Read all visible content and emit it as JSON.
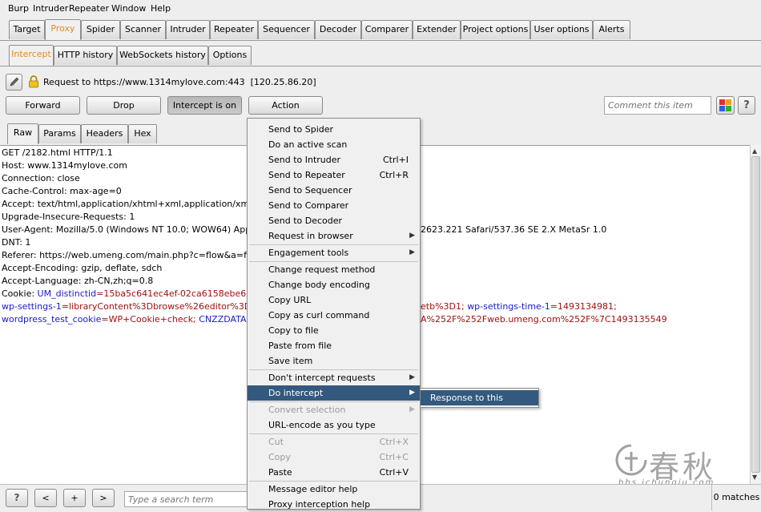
{
  "menubar": [
    "Burp",
    "Intruder",
    "Repeater",
    "Window",
    "Help"
  ],
  "main_tabs": [
    "Target",
    "Proxy",
    "Spider",
    "Scanner",
    "Intruder",
    "Repeater",
    "Sequencer",
    "Decoder",
    "Comparer",
    "Extender",
    "Project options",
    "User options",
    "Alerts"
  ],
  "proxy_tabs": [
    "Intercept",
    "HTTP history",
    "WebSockets history",
    "Options"
  ],
  "request_info": "Request to https://www.1314mylove.com:443  [120.25.86.20]",
  "buttons": {
    "forward": "Forward",
    "drop": "Drop",
    "intercept": "Intercept is on",
    "action": "Action",
    "help": "?"
  },
  "comment_placeholder": "Comment this item",
  "editor_tabs": [
    "Raw",
    "Params",
    "Headers",
    "Hex"
  ],
  "request_lines": [
    "GET /2182.html HTTP/1.1",
    "Host: www.1314mylove.com",
    "Connection: close",
    "Cache-Control: max-age=0",
    "Accept: text/html,application/xhtml+xml,application/xml;q=0.9,ima",
    "Upgrade-Insecure-Requests: 1",
    "User-Agent: Mozilla/5.0 (Windows NT 10.0; WOW64) AppleWeb",
    "DNT: 1",
    "Referer: https://web.umeng.com/main.php?c=flow&a=frame&sit",
    "Accept-Encoding: gzip, deflate, sdch",
    "Accept-Language: zh-CN,zh;q=0.8"
  ],
  "user_agent_tail": "2623.221 Safari/537.36 SE 2.X MetaSr 1.0",
  "cookie": {
    "label": "Cookie: ",
    "l1_key": "UM_distinctid",
    "l1_val": "=15ba5c641ec4ef-02ca6158ebe613-4d01",
    "l2_key": "wp-settings-1",
    "l2_val": "=libraryContent%3Dbrowse%26editor%3Dhtml%2",
    "l2_tail_val": "etb%3D1; ",
    "l2_tail_key": "wp-settings-time-1",
    "l2_tail_val2": "=1493134981;",
    "l3_key": "wordpress_test_cookie",
    "l3_val": "=WP+Cookie+check; ",
    "l3_key2": "CNZZDATA126059",
    "l3_tail": "A%252F%252Fweb.umeng.com%252F%7C1493135549"
  },
  "context_menu": [
    {
      "label": "Send to Spider",
      "accel": "",
      "submenu": false,
      "disabled": false
    },
    {
      "label": "Do an active scan",
      "accel": "",
      "submenu": false,
      "disabled": false
    },
    {
      "label": "Send to Intruder",
      "accel": "Ctrl+I",
      "submenu": false,
      "disabled": false
    },
    {
      "label": "Send to Repeater",
      "accel": "Ctrl+R",
      "submenu": false,
      "disabled": false
    },
    {
      "label": "Send to Sequencer",
      "accel": "",
      "submenu": false,
      "disabled": false
    },
    {
      "label": "Send to Comparer",
      "accel": "",
      "submenu": false,
      "disabled": false
    },
    {
      "label": "Send to Decoder",
      "accel": "",
      "submenu": false,
      "disabled": false
    },
    {
      "label": "Request in browser",
      "accel": "",
      "submenu": true,
      "disabled": false
    },
    {
      "label": "Engagement tools",
      "accel": "",
      "submenu": true,
      "disabled": false
    },
    {
      "label": "Change request method",
      "accel": "",
      "submenu": false,
      "disabled": false
    },
    {
      "label": "Change body encoding",
      "accel": "",
      "submenu": false,
      "disabled": false
    },
    {
      "label": "Copy URL",
      "accel": "",
      "submenu": false,
      "disabled": false
    },
    {
      "label": "Copy as curl command",
      "accel": "",
      "submenu": false,
      "disabled": false
    },
    {
      "label": "Copy to file",
      "accel": "",
      "submenu": false,
      "disabled": false
    },
    {
      "label": "Paste from file",
      "accel": "",
      "submenu": false,
      "disabled": false
    },
    {
      "label": "Save item",
      "accel": "",
      "submenu": false,
      "disabled": false
    },
    {
      "label": "Don't intercept requests",
      "accel": "",
      "submenu": true,
      "disabled": false
    },
    {
      "label": "Do intercept",
      "accel": "",
      "submenu": true,
      "disabled": false
    },
    {
      "label": "Convert selection",
      "accel": "",
      "submenu": true,
      "disabled": true
    },
    {
      "label": "URL-encode as you type",
      "accel": "",
      "submenu": false,
      "disabled": false
    },
    {
      "label": "Cut",
      "accel": "Ctrl+X",
      "submenu": false,
      "disabled": true
    },
    {
      "label": "Copy",
      "accel": "Ctrl+C",
      "submenu": false,
      "disabled": true
    },
    {
      "label": "Paste",
      "accel": "Ctrl+V",
      "submenu": false,
      "disabled": false
    },
    {
      "label": "Message editor help",
      "accel": "",
      "submenu": false,
      "disabled": false
    },
    {
      "label": "Proxy interception help",
      "accel": "",
      "submenu": false,
      "disabled": false
    }
  ],
  "submenu_item": "Response to this request",
  "bottom": {
    "help": "?",
    "prev": "<",
    "add": "+",
    "next": ">",
    "search_placeholder": "Type a search term",
    "matches": "0 matches"
  },
  "watermark": {
    "chars": "春秋",
    "url": "bbs.ichunqiu.com"
  },
  "colors": {
    "active_tab": "#e58a27",
    "highlight": "#34597e",
    "cookie_key": "#1a1ac8",
    "cookie_value": "#a01010"
  }
}
